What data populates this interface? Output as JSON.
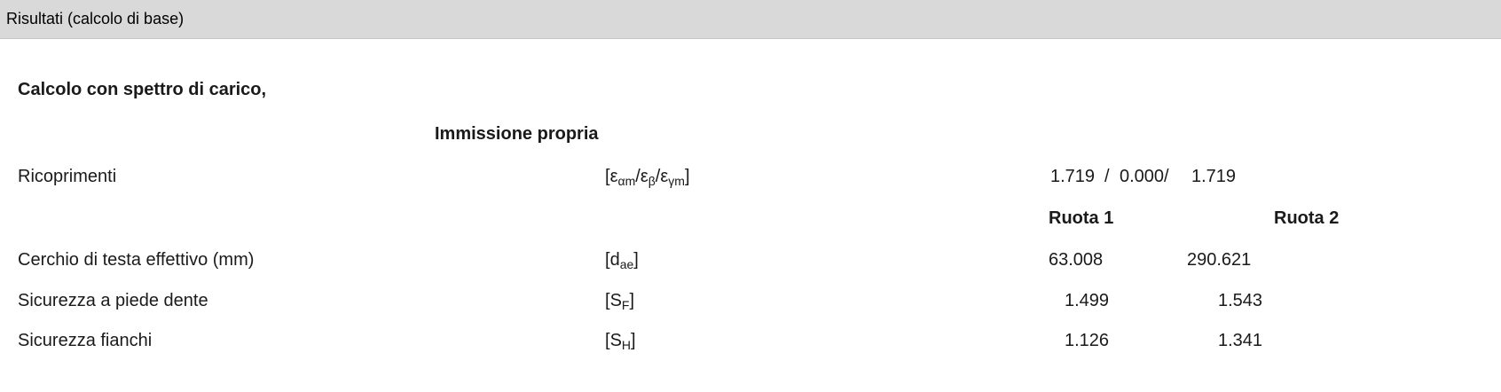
{
  "panel": {
    "title": "Risultati (calcolo di base)"
  },
  "heading": "Calcolo con spettro di carico,",
  "subheading": "Immissione propria",
  "overlaps": {
    "label": "Ricoprimenti",
    "symbol": {
      "open": "[",
      "e1": "ε",
      "s1": "αm",
      "sep1": "/",
      "e2": "ε",
      "s2": "β",
      "sep2": "/",
      "e3": "ε",
      "s3": "γm",
      "close": "]"
    },
    "value_1": "1.719",
    "sep_a": "/",
    "value_2": "0.000/",
    "value_3": "1.719"
  },
  "columns": {
    "wheel_1": "Ruota 1",
    "wheel_2": "Ruota 2"
  },
  "rows": [
    {
      "label": "Cerchio di testa effettivo (mm)",
      "sym_base": "d",
      "sym_sub": "ae",
      "v1": "63.008",
      "v2": "290.621"
    },
    {
      "label": "Sicurezza a piede dente",
      "sym_base": "S",
      "sym_sub": "F",
      "v1": "1.499",
      "v2": "1.543"
    },
    {
      "label": "Sicurezza fianchi",
      "sym_base": "S",
      "sym_sub": "H",
      "v1": "1.126",
      "v2": "1.341"
    }
  ]
}
